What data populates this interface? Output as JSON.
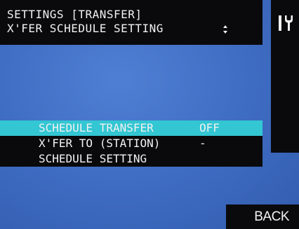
{
  "header": {
    "title": "SETTINGS [TRANSFER]",
    "subtitle": "X'FER SCHEDULE SETTING",
    "scroll_icon": "up-down-arrows-icon"
  },
  "side_panel": {
    "icon": "tools-icon"
  },
  "menu": {
    "items": [
      {
        "label": "SCHEDULE TRANSFER",
        "value": "OFF",
        "selected": true
      },
      {
        "label": "X'FER TO (STATION)",
        "value": "-",
        "selected": false
      },
      {
        "label": "SCHEDULE SETTING",
        "value": "",
        "selected": false
      }
    ]
  },
  "footer": {
    "back_label": "BACK"
  },
  "colors": {
    "background": "#3e6cc2",
    "panel": "#0a0a0c",
    "highlight": "#33c6d3",
    "text": "#f2f2f2"
  }
}
